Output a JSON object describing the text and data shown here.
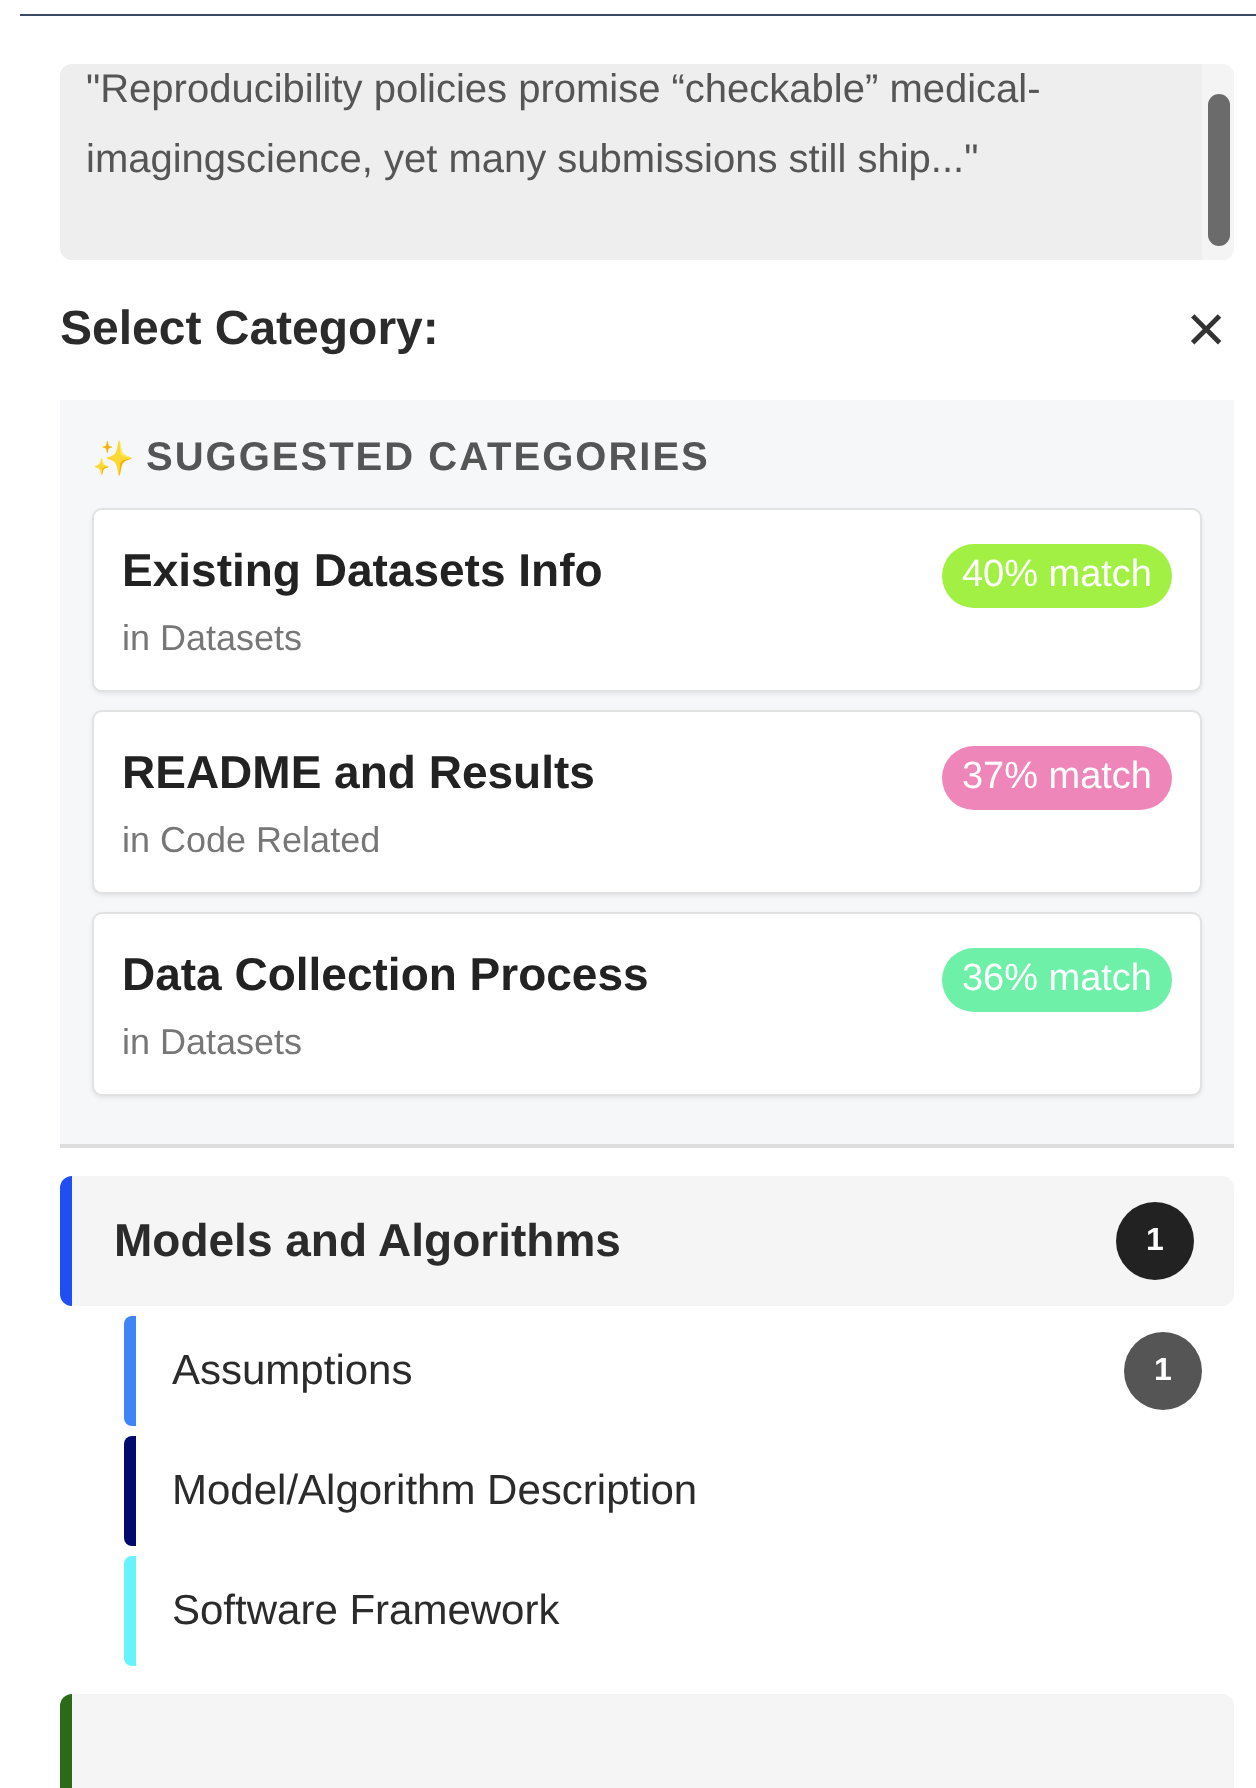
{
  "quote": "\"Reproducibility policies promise “checkable” medical-imagingscience, yet many submissions still ship...\"",
  "header": {
    "title": "Select Category:",
    "close": "×"
  },
  "suggested": {
    "icon": "✨",
    "title": "SUGGESTED CATEGORIES",
    "items": [
      {
        "name": "Existing Datasets Info",
        "parent": "in Datasets",
        "match": "40% match",
        "color": "#a3f044"
      },
      {
        "name": "README and Results",
        "parent": "in Code Related",
        "match": "37% match",
        "color": "#ef86b9"
      },
      {
        "name": "Data Collection Process",
        "parent": "in Datasets",
        "match": "36% match",
        "color": "#6ef0a8"
      }
    ]
  },
  "categories": [
    {
      "name": "Models and Algorithms",
      "count": "1",
      "color": "#1f4ef5",
      "children": [
        {
          "name": "Assumptions",
          "count": "1",
          "color": "#3f86f4"
        },
        {
          "name": "Model/Algorithm Description",
          "color": "#020a6e"
        },
        {
          "name": "Software Framework",
          "color": "#66f3f9"
        }
      ]
    },
    {
      "color": "#2a6a18"
    }
  ]
}
